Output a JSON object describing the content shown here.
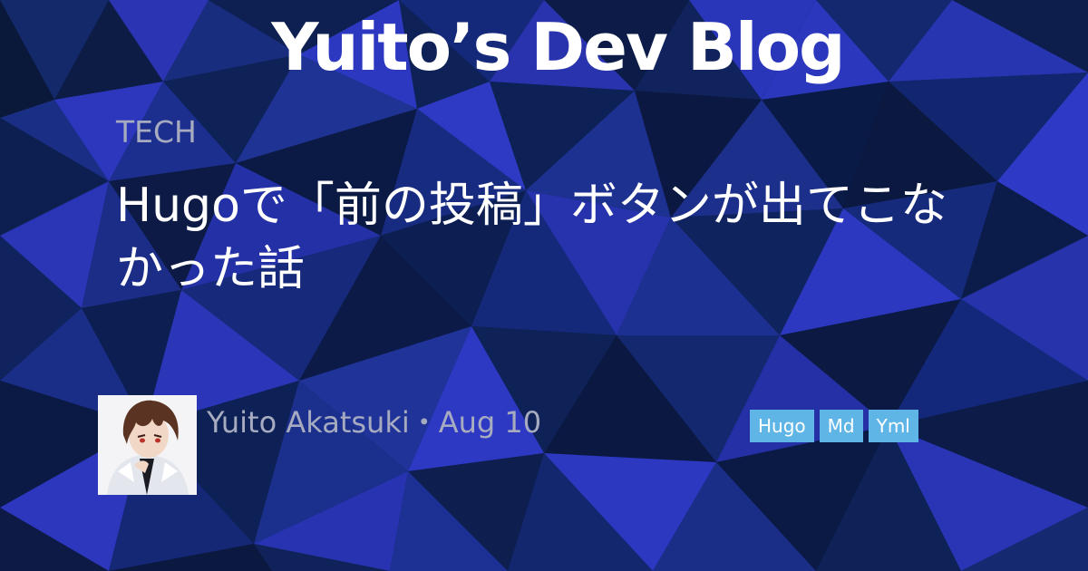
{
  "site": {
    "title": "Yuito’s Dev Blog"
  },
  "post": {
    "category": "TECH",
    "title": "Hugoで「前の投稿」ボタンが出てこなかった話",
    "author": "Yuito Akatsuki",
    "separator": "・",
    "date": "Aug 10",
    "tags": [
      "Hugo",
      "Md",
      "Yml"
    ]
  },
  "colors": {
    "background": "#0b1a3f",
    "accent_blue": "#2d37b8",
    "tag_bg": "#5fb6e6",
    "muted_text": "#a7abc0"
  },
  "icons": {
    "avatar": "anime-avatar-image"
  }
}
